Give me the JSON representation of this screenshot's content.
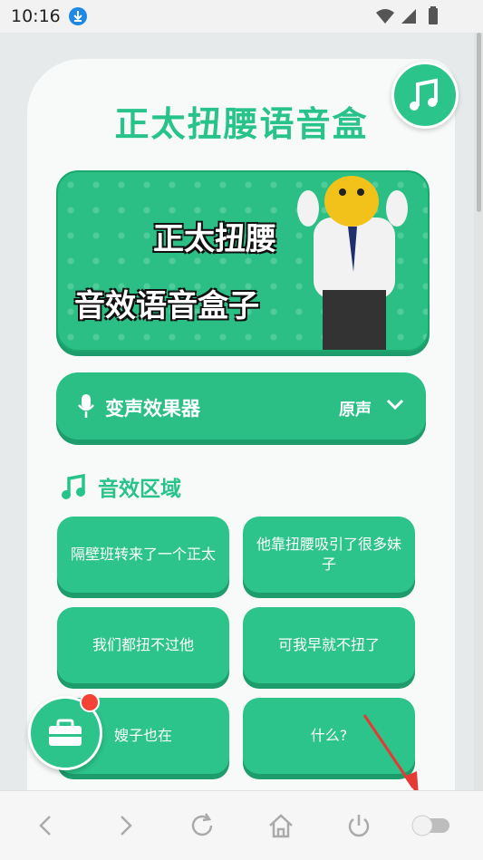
{
  "status": {
    "time": "10:16"
  },
  "app": {
    "title": "正太扭腰语音盒",
    "banner": {
      "line1": "正太扭腰",
      "line2": "音效语音盒子"
    },
    "voice_changer": {
      "label": "变声效果器",
      "value": "原声"
    },
    "section_title": "音效区域",
    "sounds": [
      "隔壁班转来了一个正太",
      "他靠扭腰吸引了很多妹子",
      "我们都扭不过他",
      "可我早就不扭了",
      "嫂子也在",
      "什么?"
    ]
  },
  "colors": {
    "accent": "#2cc48a",
    "accent_dark": "#1e9c6c",
    "title": "#27c38b",
    "badge": "#f44336"
  },
  "icons": [
    "music-note-icon",
    "microphone-icon",
    "chevron-down-icon",
    "toolbox-icon",
    "back-icon",
    "forward-icon",
    "refresh-icon",
    "home-icon",
    "power-icon",
    "toggle-icon"
  ]
}
